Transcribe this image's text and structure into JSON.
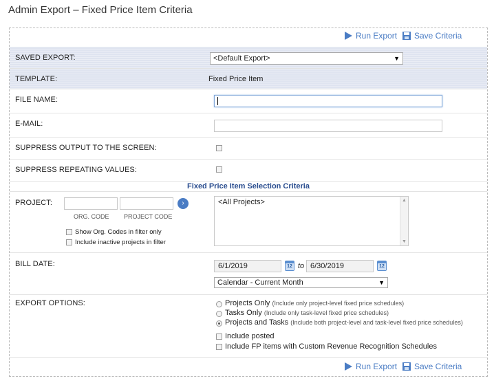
{
  "page": {
    "title": "Admin Export – Fixed Price Item Criteria"
  },
  "toolbar": {
    "run_export": "Run Export",
    "save_criteria": "Save Criteria"
  },
  "saved_export": {
    "label": "SAVED EXPORT:",
    "value": "<Default Export>"
  },
  "template": {
    "label": "TEMPLATE:",
    "value": "Fixed Price Item"
  },
  "file_name": {
    "label": "FILE NAME:",
    "value": ""
  },
  "email": {
    "label": "E-MAIL:",
    "value": ""
  },
  "suppress_output": {
    "label": "SUPPRESS OUTPUT TO THE SCREEN:",
    "checked": false
  },
  "suppress_repeating": {
    "label": "SUPPRESS REPEATING VALUES:",
    "checked": false
  },
  "section": {
    "title": "Fixed Price Item Selection Criteria"
  },
  "project": {
    "label": "PROJECT:",
    "org_code_caption": "ORG. CODE",
    "project_code_caption": "PROJECT CODE",
    "show_org_codes": "Show Org. Codes in filter only",
    "include_inactive": "Include inactive projects in filter",
    "list_items": [
      "<All Projects>"
    ]
  },
  "bill_date": {
    "label": "BILL DATE:",
    "from": "6/1/2019",
    "to_label": "to",
    "to": "6/30/2019",
    "calendar_icon_text": "12",
    "period": "Calendar - Current Month"
  },
  "export_options": {
    "label": "EXPORT OPTIONS:",
    "options": [
      {
        "label": "Projects Only",
        "note": "(Include only project-level fixed price schedules)",
        "checked": false
      },
      {
        "label": "Tasks Only",
        "note": "(Include only task-level fixed price schedules)",
        "checked": false
      },
      {
        "label": "Projects and Tasks",
        "note": "(Include both project-level and task-level fixed price schedules)",
        "checked": true
      }
    ],
    "include_posted": "Include posted",
    "include_fp_custom": "Include FP items with Custom Revenue Recognition Schedules"
  },
  "colors": {
    "accent": "#4a7cc4",
    "shaded_row": "#dfe4f0",
    "section_title": "#2a4d8f"
  }
}
